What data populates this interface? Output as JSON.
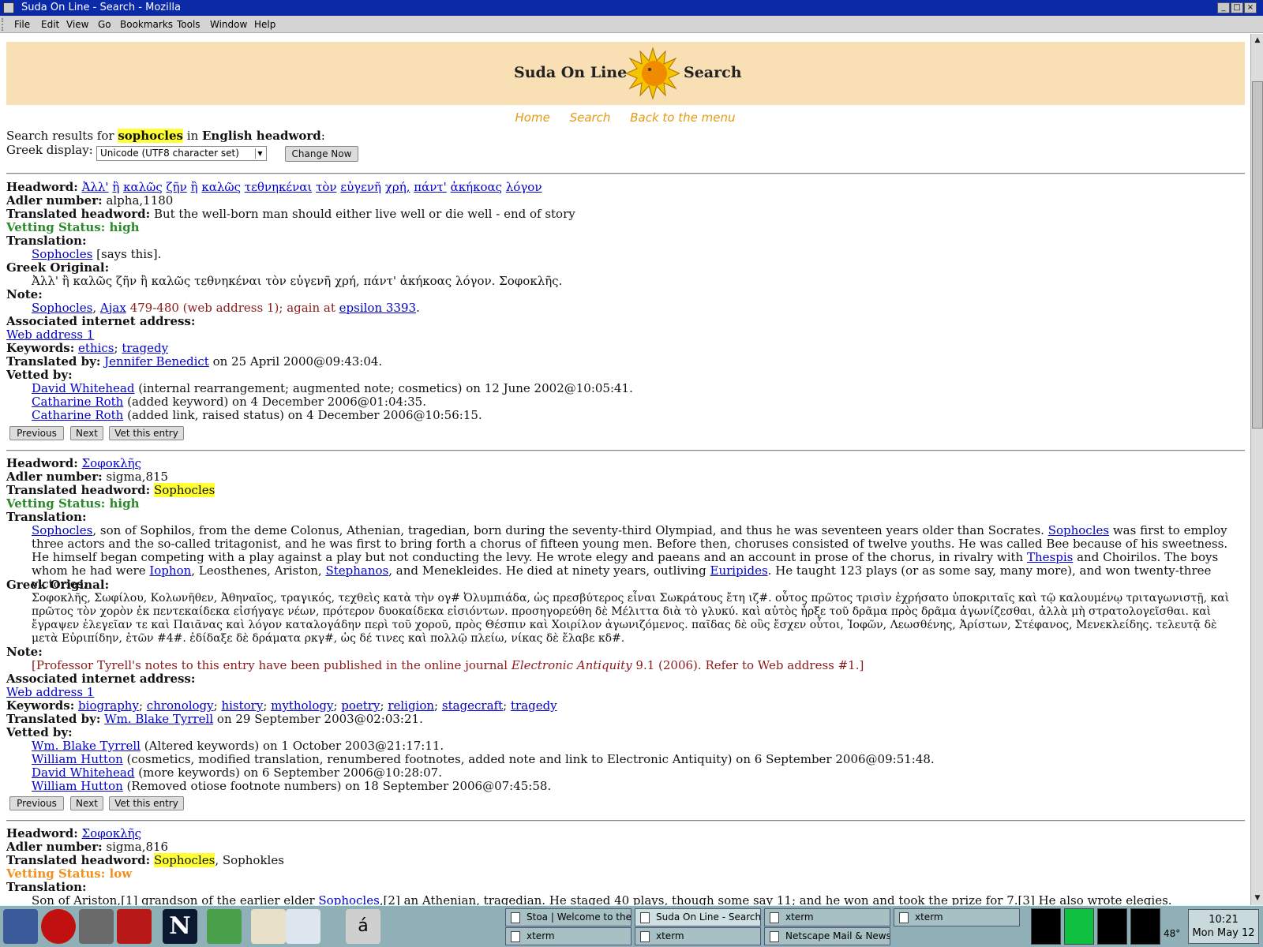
{
  "window": {
    "title": "Suda On Line - Search - Mozilla"
  },
  "menu": [
    "File",
    "Edit",
    "View",
    "Go",
    "Bookmarks",
    "Tools",
    "Window",
    "Help"
  ],
  "header": {
    "left_text": "Suda On Line",
    "right_text": "Search"
  },
  "nav": [
    "Home",
    "Search",
    "Back to the menu"
  ],
  "search": {
    "prefix": "Search results for ",
    "term": "sophocles",
    "mid": " in ",
    "field": "English headword",
    "suffix": ":",
    "greek_display_label": "Greek display:",
    "greek_display_value": "Unicode (UTF8 character set)",
    "change_button": "Change Now"
  },
  "labels": {
    "headword": "Headword:",
    "adler": "Adler number:",
    "translated_headword": "Translated headword:",
    "translation": "Translation:",
    "greek_original": "Greek Original:",
    "note": "Note:",
    "assoc": "Associated internet address:",
    "keywords": "Keywords:",
    "translated_by": "Translated by:",
    "vetted_by": "Vetted by:",
    "previous": "Previous",
    "next": "Next",
    "vet": "Vet this entry",
    "web1": "Web address 1"
  },
  "entry1": {
    "headword_words": [
      "Ἀλλ'",
      "ἢ",
      "καλῶς",
      "ζῆν",
      "ἢ",
      "καλῶς",
      "τεθνηκέναι",
      "τὸν",
      "εὐγενῆ",
      "χρή,",
      "πάντ'",
      "ἀκήκοας",
      "λόγον"
    ],
    "adler": "alpha,1180",
    "translated_headword": "But the well-born man should either live well or die well - end of story",
    "vetting": "Vetting Status: high",
    "translation_link": "Sophocles",
    "translation_rest": " [says this].",
    "greek": "Ἀλλ' ἢ καλῶς ζῆν ἢ καλῶς τεθνηκέναι τὸν εὐγενῆ χρή, πάντ' ἀκήκοας λόγον. Σοφοκλῆς.",
    "note_link1": "Sophocles",
    "note_sep": ", ",
    "note_link2": "Ajax",
    "note_red": " 479-480 (web address 1); again at ",
    "note_link3": "epsilon 3393",
    "note_end": ".",
    "keywords": [
      "ethics",
      "tragedy"
    ],
    "translated_by_name": "Jennifer Benedict",
    "translated_by_date": " on 25 April 2000@09:43:04.",
    "vetters": [
      {
        "name": "David Whitehead",
        "text": " (internal rearrangement; augmented note; cosmetics) on 12 June 2002@10:05:41."
      },
      {
        "name": "Catharine Roth",
        "text": " (added keyword) on 4 December 2006@01:04:35."
      },
      {
        "name": "Catharine Roth",
        "text": " (added link, raised status) on 4 December 2006@10:56:15."
      }
    ]
  },
  "entry2": {
    "headword": "Σοφοκλῆς",
    "adler": "sigma,815",
    "translated_headword": "Sophocles",
    "vetting": "Vetting Status: high",
    "t1_link": "Sophocles",
    "t1": ", son of Sophilos, from the deme Colonus, Athenian, tragedian, born during the seventy-third Olympiad, and thus he was seventeen years older than Socrates. ",
    "t2_link": "Sophocles",
    "t2": " was first to employ three actors and the so-called tritagonist, and he was first to bring forth a chorus of fifteen young men. Before then, choruses consisted of twelve youths. He was called Bee because of his sweetness. He himself began competing with a play against a play but not conducting the levy. He wrote elegy and paeans and an account in prose of the chorus, in rivalry with ",
    "t3_link": "Thespis",
    "t3": " and Choirilos. The boys whom he had were ",
    "t4_link": "Iophon",
    "t4": ", Leosthenes, Ariston, ",
    "t5_link": "Stephanos",
    "t5": ", and Menekleides. He died at ninety years, outliving ",
    "t6_link": "Euripides",
    "t6": ". He taught 123 plays (or as some say, many more), and won twenty-three victories.",
    "greek": "Σοφοκλῆς, Σωφίλου, Κολωνῆθεν, Ἀθηναῖος, τραγικός, τεχθεὶς κατὰ τὴν ογ# Ὀλυμπιάδα, ὡς πρεσβύτερος εἶναι Σωκράτους ἔτη ιζ#. οὗτος πρῶτος τρισὶν ἐχρήσατο ὑποκριταῖς καὶ τῷ καλουμένῳ τριταγωνιστῇ, καὶ πρῶτος τὸν χορὸν ἐκ πεντεκαίδεκα εἰσήγαγε νέων, πρότερον δυοκαίδεκα εἰσιόντων. προσηγορεύθη δὲ Μέλιττα διὰ τὸ γλυκύ. καὶ αὐτὸς ἦρξε τοῦ δρᾶμα πρὸς δρᾶμα ἀγωνίζεσθαι, ἀλλὰ μὴ στρατολογεῖσθαι. καὶ ἔγραψεν ἐλεγεῖαν τε καὶ Παιᾶνας καὶ λόγον καταλογάδην περὶ τοῦ χοροῦ, πρὸς Θέσπιν καὶ Χοιρίλον ἀγωνιζόμενος. παῖδας δὲ οὓς ἔσχεν οὗτοι, Ἰοφῶν, Λεωσθένης, Ἀρίστων, Στέφανος, Μενεκλείδης. τελευτᾷ δὲ μετὰ Εὐριπίδην, ἐτῶν #4#. ἐδίδαξε δὲ δράματα ρκγ#, ὡς δέ τινες καὶ πολλῷ πλείω, νίκας δὲ ἔλαβε κδ#.",
    "note_a": "[Professor Tyrell's notes to this entry have been published in the online journal ",
    "note_i": "Electronic Antiquity",
    "note_b": " 9.1 (2006). Refer to Web address #1.]",
    "keywords": [
      "biography",
      "chronology",
      "history",
      "mythology",
      "poetry",
      "religion",
      "stagecraft",
      "tragedy"
    ],
    "translated_by_name": "Wm. Blake Tyrrell",
    "translated_by_date": " on 29 September 2003@02:03:21.",
    "vetters": [
      {
        "name": "Wm. Blake Tyrrell",
        "text": " (Altered keywords) on 1 October 2003@21:17:11."
      },
      {
        "name": "William Hutton",
        "text": " (cosmetics, modified translation, renumbered footnotes, added note and link to Electronic Antiquity) on 6 September 2006@09:51:48."
      },
      {
        "name": "David Whitehead",
        "text": " (more keywords) on 6 September 2006@10:28:07."
      },
      {
        "name": "William Hutton",
        "text": " (Removed otiose footnote numbers) on 18 September 2006@07:45:58."
      }
    ]
  },
  "entry3": {
    "headword": "Σοφοκλῆς",
    "adler": "sigma,816",
    "translated_headword": "Sophocles",
    "translated_headword_rest": ", Sophokles",
    "vetting": "Vetting Status: low",
    "t_a": "Son of Ariston,[1] grandson of the earlier elder ",
    "t_link": "Sophocles",
    "t_b": ",[2] an Athenian, tragedian. He staged 40 plays, though some say 11; and he won and took the prize for 7.[3] He also wrote elegies."
  },
  "taskbar": {
    "tasks_top": [
      "Stoa | Welcome to the S",
      "Suda On Line - Search -",
      "xterm",
      "xterm"
    ],
    "tasks_bottom": [
      "xterm",
      "xterm",
      "Netscape Mail & Newsg"
    ],
    "temp": "48°",
    "time": "10:21",
    "date": "Mon May 12"
  },
  "colors": {
    "titlebar": "#0a2aa8",
    "header_bg": "#f8dfb4",
    "nav": "#e59a10",
    "link": "#0000cc",
    "vetting_high": "#2a8a2a",
    "vetting_low": "#f09020",
    "note_red": "#8b1a1a",
    "highlight": "#ffff33"
  }
}
